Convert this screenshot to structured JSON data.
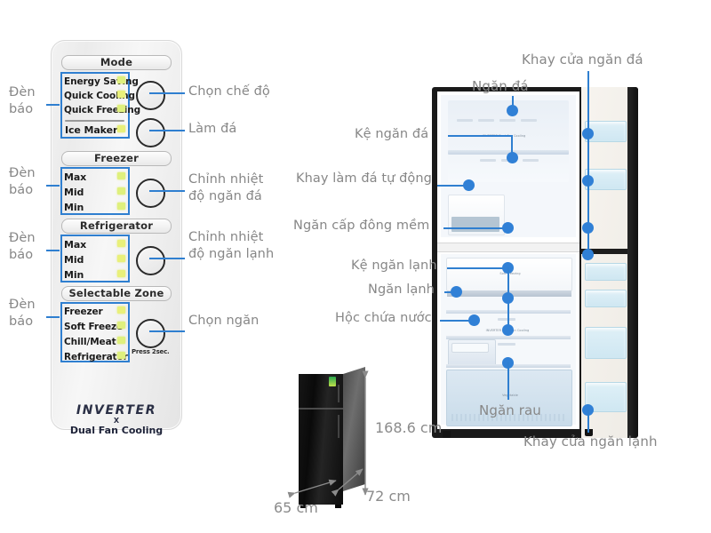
{
  "control_panel": {
    "sections": [
      {
        "title": "Mode",
        "indicators": [
          "Energy Saving",
          "Quick Cooling",
          "Quick Freezing"
        ],
        "extra_indicators": [
          "Ice Maker"
        ],
        "buttons": [
          "mode-button",
          "ice-maker-button"
        ]
      },
      {
        "title": "Freezer",
        "indicators": [
          "Max",
          "Mid",
          "Min"
        ],
        "buttons": [
          "freezer-temp-button"
        ]
      },
      {
        "title": "Refrigerator",
        "indicators": [
          "Max",
          "Mid",
          "Min"
        ],
        "buttons": [
          "refrigerator-temp-button"
        ]
      },
      {
        "title": "Selectable Zone",
        "indicators": [
          "Freezer",
          "Soft Freeze",
          "Chill/Meat",
          "Refrigerator"
        ],
        "button_hint": "Press 2sec.",
        "buttons": [
          "selectable-zone-button"
        ]
      }
    ],
    "brand": {
      "line1": "INVERTER",
      "symbol": "X",
      "line2": "Dual Fan Cooling"
    },
    "left_callouts": [
      "Đèn báo",
      "Đèn báo",
      "Đèn báo",
      "Đèn báo"
    ],
    "right_callouts": [
      "Chọn chế độ",
      "Làm đá",
      "Chỉnh nhiệt độ ngăn đá",
      "Chỉnh nhiệt độ ngăn lạnh",
      "Chọn ngăn"
    ]
  },
  "fridge_callouts": {
    "khay_cua_ngan_da": "Khay cửa ngăn đá",
    "ngan_da": "Ngăn đá",
    "ke_ngan_da": "Kệ ngăn đá",
    "khay_lam_da_tu_dong": "Khay làm đá tự động",
    "ngan_cap_dong_mem": "Ngăn cấp đông mềm",
    "ke_ngan_lanh": "Kệ ngăn lạnh",
    "ngan_lanh": "Ngăn lạnh",
    "hoc_chua_nuoc": "Hộc chứa nước",
    "ngan_rau": "Ngăn rau",
    "khay_cua_ngan_lanh": "Khay cửa ngăn lạnh"
  },
  "dimensions": {
    "height": "168.6 cm",
    "width": "65 cm",
    "depth": "72 cm"
  },
  "colors": {
    "accent_blue": "#3080d6",
    "label_gray": "#878787",
    "led_yellow": "#e9f07a",
    "cabinet_black": "#1a1a1a"
  },
  "interior_microtext": {
    "freezer_logo": "INVERTER Dual Fan Cooling",
    "softfreeze_logo": "Soft Freezing",
    "fridge_logo": "INVERTER Dual Fan Cooling",
    "veg_logo": "Vegetable"
  }
}
